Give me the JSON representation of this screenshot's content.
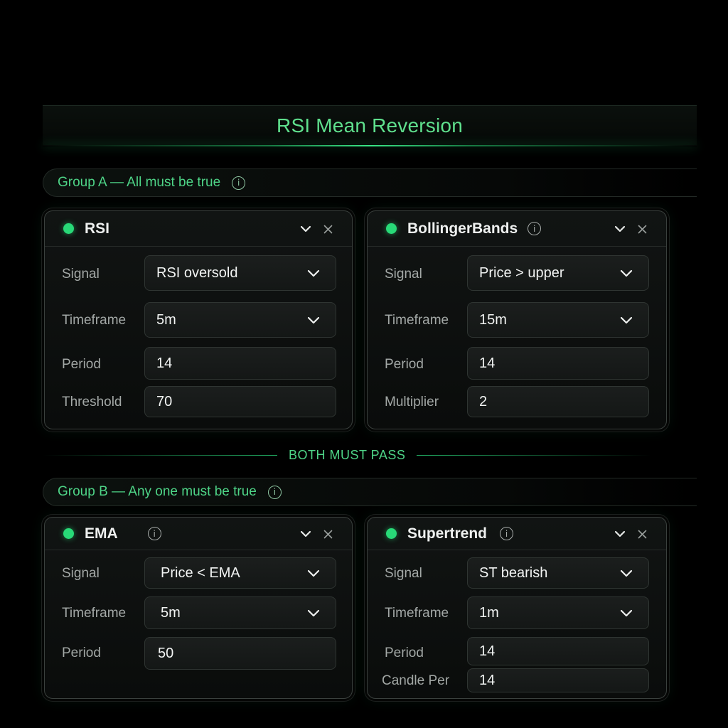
{
  "strategy": {
    "title": "RSI Mean Reversion"
  },
  "group_a": {
    "label": "Group A — All must be true",
    "cards": [
      {
        "title": "RSI",
        "rows": [
          {
            "label": "Signal",
            "value": "RSI oversold",
            "type": "select"
          },
          {
            "label": "Timeframe",
            "value": "5m",
            "type": "select"
          },
          {
            "label": "Period",
            "value": "14",
            "type": "input"
          },
          {
            "label": "Threshold",
            "value": "70",
            "type": "input"
          }
        ]
      },
      {
        "title": "BollingerBands",
        "rows": [
          {
            "label": "Signal",
            "value": "Price > upper",
            "type": "select"
          },
          {
            "label": "Timeframe",
            "value": "15m",
            "type": "select"
          },
          {
            "label": "Period",
            "value": "14",
            "type": "input"
          },
          {
            "label": "Multiplier",
            "value": "2",
            "type": "input"
          }
        ]
      }
    ]
  },
  "combiner": {
    "label": "BOTH MUST PASS"
  },
  "group_b": {
    "label": "Group B — Any one must be true",
    "cards": [
      {
        "title": "EMA",
        "rows": [
          {
            "label": "Signal",
            "value": "Price < EMA",
            "type": "select"
          },
          {
            "label": "Timeframe",
            "value": "5m",
            "type": "select"
          },
          {
            "label": "Period",
            "value": "50",
            "type": "input"
          }
        ]
      },
      {
        "title": "Supertrend",
        "rows": [
          {
            "label": "Signal",
            "value": "ST bearish",
            "type": "select"
          },
          {
            "label": "Timeframe",
            "value": "1m",
            "type": "select"
          },
          {
            "label": "Period",
            "value": "14",
            "type": "input"
          },
          {
            "label": "Candle Per",
            "value": "14",
            "type": "input"
          }
        ]
      }
    ]
  },
  "icons": {
    "status": "status-dot-icon",
    "info": "info-icon",
    "collapse": "chevron-down-icon",
    "remove": "close-icon",
    "dropdown": "chevron-down-icon"
  },
  "colors": {
    "accent": "#28d977",
    "accent_text": "#4ed487",
    "background": "#000000",
    "card": "#101312",
    "field": "#181b1a"
  }
}
